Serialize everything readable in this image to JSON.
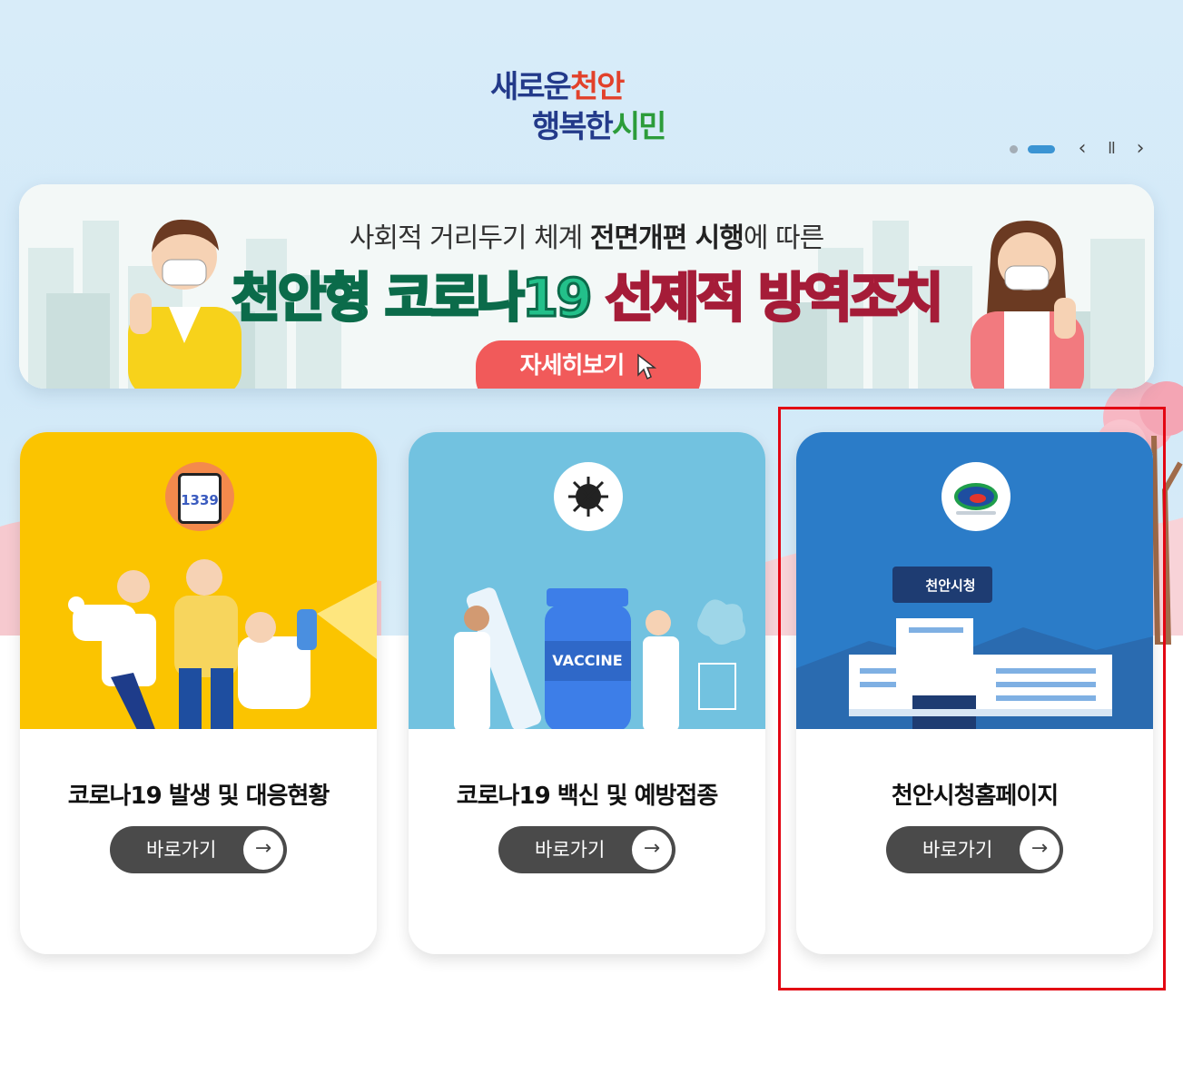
{
  "logo": {
    "line1_a": "새로운",
    "line1_b": "천안",
    "line2_a": "행복한",
    "line2_b": "시민"
  },
  "slider": {
    "prev_symbol": "‹",
    "pause_symbol": "ll",
    "next_symbol": "›"
  },
  "banner": {
    "subtitle_pre": "사회적 거리두기 체계 ",
    "subtitle_bold": "전면개편 시행",
    "subtitle_post": "에 따른",
    "main_green": "천안형 코로나19 ",
    "main_red": "선제적 방역조치",
    "button_label": "자세히보기"
  },
  "cards": [
    {
      "badge_text": "1339",
      "title": "코로나19 발생 및 대응현황",
      "button_label": "바로가기",
      "color": "#fbc400"
    },
    {
      "title": "코로나19 백신 및 예방접종",
      "button_label": "바로가기",
      "bottle_text": "VACCINE",
      "color": "#72c2e0"
    },
    {
      "title": "천안시청홈페이지",
      "button_label": "바로가기",
      "sign_text": "천안시청",
      "color": "#2b7cc8"
    }
  ],
  "arrow_symbol": "→",
  "colors": {
    "highlight": "#e30613",
    "button_dark": "#4a4a4a",
    "banner_button": "#f15a5a"
  }
}
